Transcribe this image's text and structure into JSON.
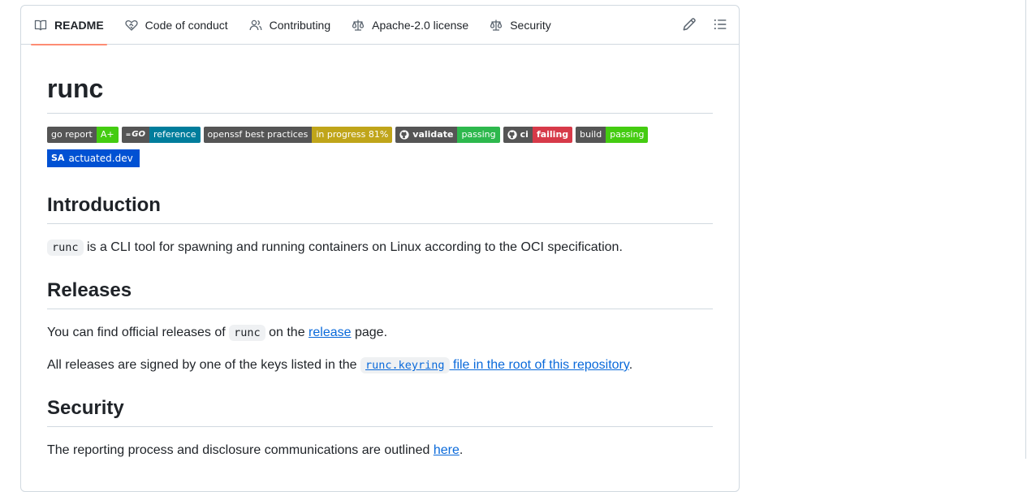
{
  "tabs": [
    {
      "label": "README",
      "icon": "book-icon",
      "active": true
    },
    {
      "label": "Code of conduct",
      "icon": "heart-handshake-icon"
    },
    {
      "label": "Contributing",
      "icon": "people-icon"
    },
    {
      "label": "Apache-2.0 license",
      "icon": "law-icon"
    },
    {
      "label": "Security",
      "icon": "law-icon"
    }
  ],
  "toolbar": {
    "edit_icon": "pencil-icon",
    "toc_icon": "list-unordered-icon"
  },
  "readme": {
    "title": "runc",
    "badges": [
      {
        "left": "go report",
        "right": "A+",
        "color": "#4c1"
      },
      {
        "left": "GO",
        "right": "reference",
        "color": "#007d9c",
        "logo": "go-logo"
      },
      {
        "left": "openssf best practices",
        "right": "in progress 81%",
        "color": "#c0a51a"
      },
      {
        "left": "validate",
        "right": "passing",
        "color": "#2db84d",
        "logo": "github-logo"
      },
      {
        "left": "ci",
        "right": "failing",
        "color": "#d73a49",
        "logo": "github-logo"
      },
      {
        "left": "build",
        "right": "passing",
        "color": "#4c1"
      }
    ],
    "badge_actuated": {
      "prefix": "SA",
      "label": "actuated.dev",
      "color": "#0051d3"
    },
    "intro_heading": "Introduction",
    "intro_code": "runc",
    "intro_text": " is a CLI tool for spawning and running containers on Linux according to the OCI specification.",
    "releases_heading": "Releases",
    "releases_p1_before": "You can find official releases of ",
    "releases_p1_code": "runc",
    "releases_p1_mid": " on the ",
    "releases_p1_link": "release",
    "releases_p1_after": " page.",
    "releases_p2_before": "All releases are signed by one of the keys listed in the ",
    "releases_p2_link_code": "runc.keyring",
    "releases_p2_link_text": " file in the root of this repository",
    "releases_p2_after": ".",
    "security_heading": "Security",
    "security_before": "The reporting process and disclosure communications are outlined ",
    "security_link": "here",
    "security_after": "."
  }
}
